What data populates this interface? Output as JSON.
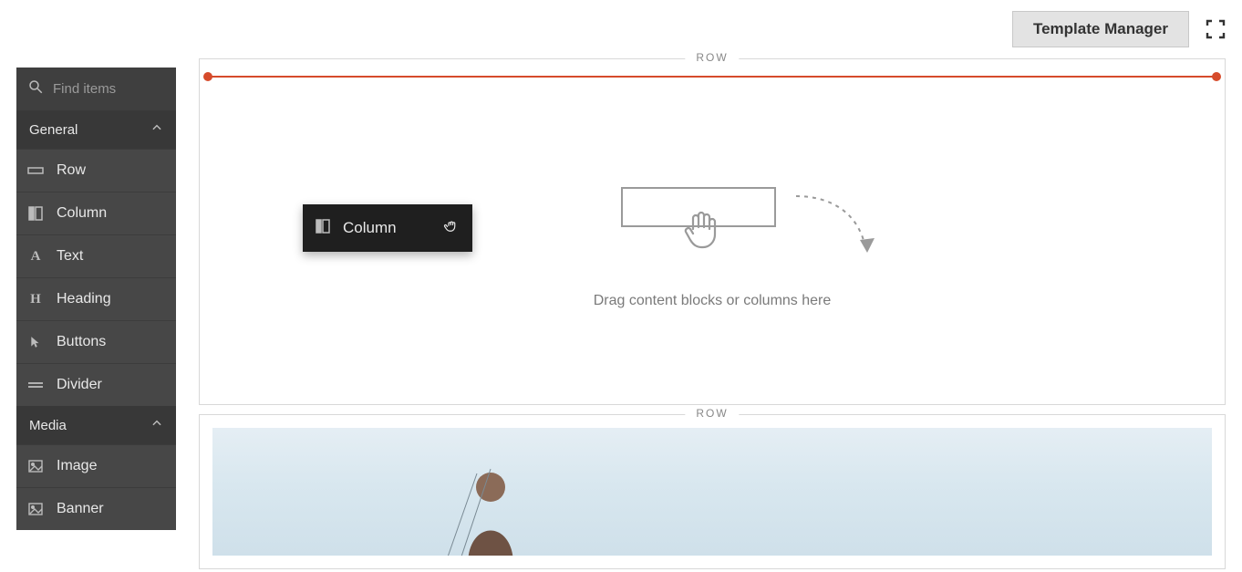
{
  "topbar": {
    "template_manager_label": "Template Manager"
  },
  "sidebar": {
    "search_placeholder": "Find items",
    "sections": [
      {
        "title": "General",
        "items": [
          {
            "label": "Row"
          },
          {
            "label": "Column"
          },
          {
            "label": "Text"
          },
          {
            "label": "Heading"
          },
          {
            "label": "Buttons"
          },
          {
            "label": "Divider"
          }
        ]
      },
      {
        "title": "Media",
        "items": [
          {
            "label": "Image"
          },
          {
            "label": "Banner"
          }
        ]
      }
    ]
  },
  "canvas": {
    "row_label": "ROW",
    "drop_hint": "Drag content blocks or columns here",
    "drag_ghost_label": "Column"
  }
}
